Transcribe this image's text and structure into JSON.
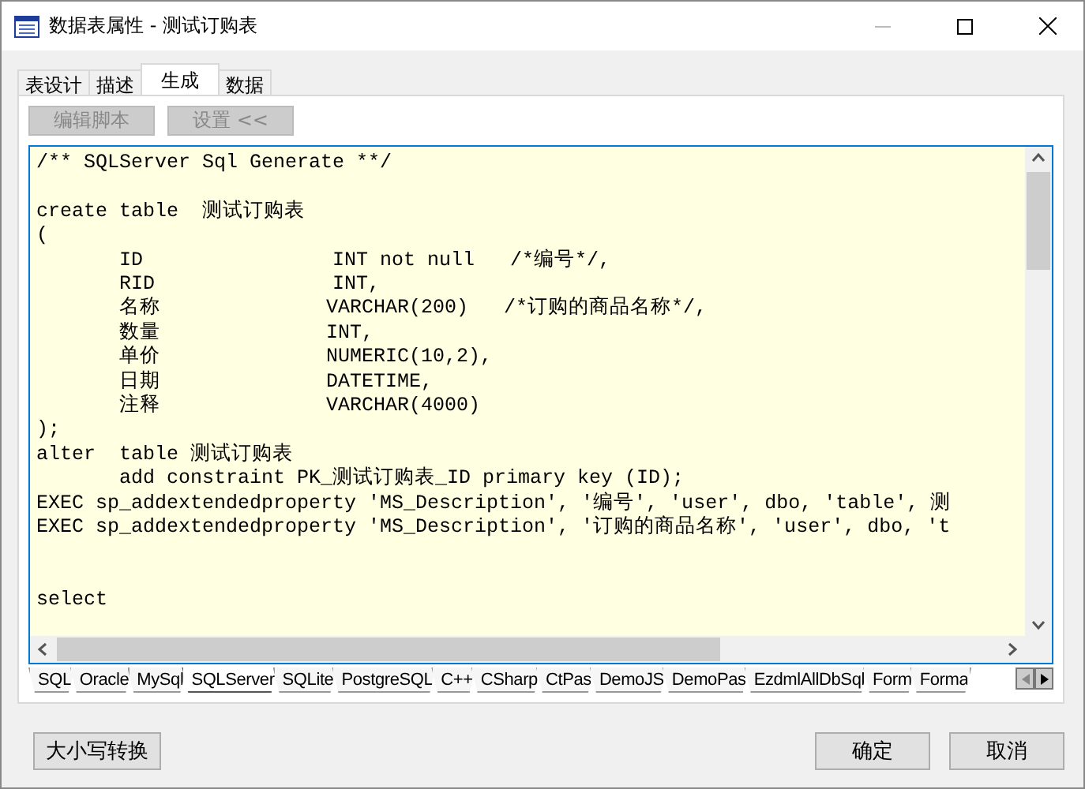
{
  "window": {
    "title": "数据表属性 - 测试订购表"
  },
  "tabs": [
    {
      "label": "表设计",
      "selected": false
    },
    {
      "label": "描述",
      "selected": false
    },
    {
      "label": "生成",
      "selected": true
    },
    {
      "label": "数据",
      "selected": false
    }
  ],
  "toolbar": [
    {
      "label": "编辑脚本",
      "disabled": true
    },
    {
      "label": "设置 <<",
      "disabled": true
    }
  ],
  "editor": {
    "text": "/** SQLServer Sql Generate **/\n\ncreate table  测试订购表\n(\n       ID                INT not null   /*编号*/,\n       RID               INT,\n       名称              VARCHAR(200)   /*订购的商品名称*/,\n       数量              INT,\n       单价              NUMERIC(10,2),\n       日期              DATETIME,\n       注释              VARCHAR(4000)\n);\nalter  table 测试订购表\n       add constraint PK_测试订购表_ID primary key (ID);\nEXEC sp_addextendedproperty 'MS_Description', '编号', 'user', dbo, 'table', 测\nEXEC sp_addextendedproperty 'MS_Description', '订购的商品名称', 'user', dbo, 't\n\n\nselect"
  },
  "dialect_tabs": [
    {
      "label": "SQL",
      "selected": false
    },
    {
      "label": "Oracle",
      "selected": false
    },
    {
      "label": "MySql",
      "selected": false
    },
    {
      "label": "SQLServer",
      "selected": true
    },
    {
      "label": "SQLite",
      "selected": false
    },
    {
      "label": "PostgreSQL",
      "selected": false
    },
    {
      "label": "C++",
      "selected": false
    },
    {
      "label": "CSharp",
      "selected": false
    },
    {
      "label": "CtPas",
      "selected": false
    },
    {
      "label": "DemoJS",
      "selected": false
    },
    {
      "label": "DemoPas",
      "selected": false
    },
    {
      "label": "EzdmlAllDbSql",
      "selected": false
    },
    {
      "label": "Form",
      "selected": false
    },
    {
      "label": "Forma",
      "selected": false
    }
  ],
  "buttons": {
    "left": "大小写转换",
    "ok": "确定",
    "cancel": "取消"
  }
}
